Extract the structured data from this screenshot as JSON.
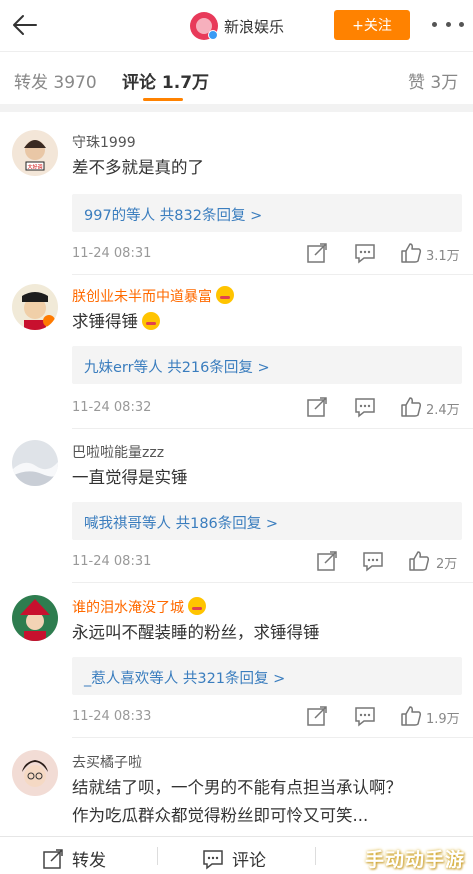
{
  "header": {
    "back_icon": "back-arrow-icon",
    "account_name": "新浪娱乐",
    "follow_label": "+关注",
    "more_icon": "more-dots-icon"
  },
  "tabs": {
    "repost": "转发 3970",
    "comments": "评论 1.7万",
    "likes": "赞 3万"
  },
  "comments": [
    {
      "user": "守珠1999",
      "text": "差不多就是真的了",
      "reply_summary": "997的等人  共832条回复 >",
      "time": "11-24 08:31",
      "likes": "3.1万"
    },
    {
      "user": "朕创业未半而中道暴富",
      "text": "求锤得锤",
      "reply_summary": "九妹err等人  共216条回复 >",
      "time": "11-24 08:32",
      "likes": "2.4万"
    },
    {
      "user": "巴啦啦能量zzz",
      "text": "一直觉得是实锤",
      "reply_summary": "喊我祺哥等人  共186条回复 >",
      "time": "11-24 08:31",
      "likes": "2万"
    },
    {
      "user": "谁的泪水淹没了城",
      "text": "永远叫不醒装睡的粉丝，求锤得锤",
      "reply_summary": "_惹人喜欢等人  共321条回复 >",
      "time": "11-24 08:33",
      "likes": "1.9万"
    },
    {
      "user": "去买橘子啦",
      "text_line1": "结就结了呗，一个男的不能有点担当承认啊？",
      "text_line2": "作为吃瓜群众都觉得粉丝即可怜又可笑..."
    }
  ],
  "bottom_bar": {
    "repost": "转发",
    "comment": "评论"
  },
  "watermark": "手动动手游",
  "colors": {
    "accent": "#ff8200",
    "link": "#3a7dbe",
    "vip_name": "#ff6a00"
  }
}
